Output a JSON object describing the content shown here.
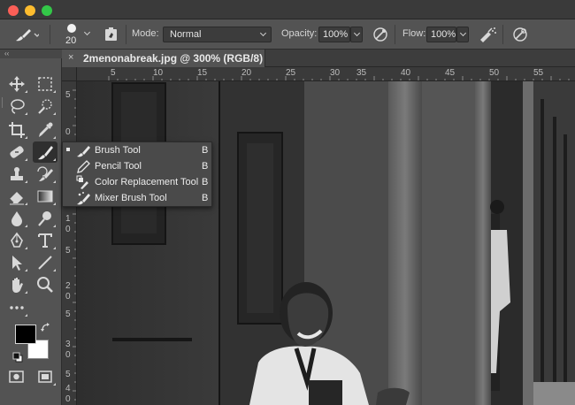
{
  "window": {
    "traffic_lights": [
      "close",
      "minimize",
      "zoom"
    ]
  },
  "options_bar": {
    "brush_size": "20",
    "mode_label": "Mode:",
    "mode_value": "Normal",
    "opacity_label": "Opacity:",
    "opacity_value": "100%",
    "flow_label": "Flow:",
    "flow_value": "100%"
  },
  "tools_panel": {
    "collapse_label": "‹‹",
    "foreground_color": "#000000",
    "background_color": "#ffffff",
    "tools": [
      "move-icon",
      "marquee-icon",
      "lasso-icon",
      "quick-selection-icon",
      "crop-icon",
      "eyedropper-icon",
      "healing-icon",
      "brush-icon",
      "clone-stamp-icon",
      "history-brush-icon",
      "eraser-icon",
      "gradient-icon",
      "blur-icon",
      "dodge-icon",
      "pen-icon",
      "type-icon",
      "path-selection-icon",
      "line-icon",
      "hand-icon",
      "zoom-icon",
      "more-tools-icon",
      "quick-mask-icon",
      "screen-mode-icon"
    ]
  },
  "document": {
    "tab_close": "×",
    "tab_title": "2menonabreak.jpg @ 300% (RGB/8)"
  },
  "ruler": {
    "top": [
      "5",
      "10",
      "15",
      "20",
      "25",
      "30",
      "35",
      "40",
      "45",
      "50",
      "55"
    ],
    "left": [
      "5",
      "0",
      "5",
      "1",
      "0",
      "5",
      "2",
      "0",
      "5",
      "3",
      "0",
      "5",
      "4",
      "0"
    ]
  },
  "flyout": {
    "items": [
      {
        "label": "Brush Tool",
        "key": "B",
        "icon": "brush-icon",
        "selected": true
      },
      {
        "label": "Pencil Tool",
        "key": "B",
        "icon": "pencil-icon",
        "selected": false
      },
      {
        "label": "Color Replacement Tool",
        "key": "B",
        "icon": "color-replacement-icon",
        "selected": false
      },
      {
        "label": "Mixer Brush Tool",
        "key": "B",
        "icon": "mixer-brush-icon",
        "selected": false
      }
    ]
  }
}
